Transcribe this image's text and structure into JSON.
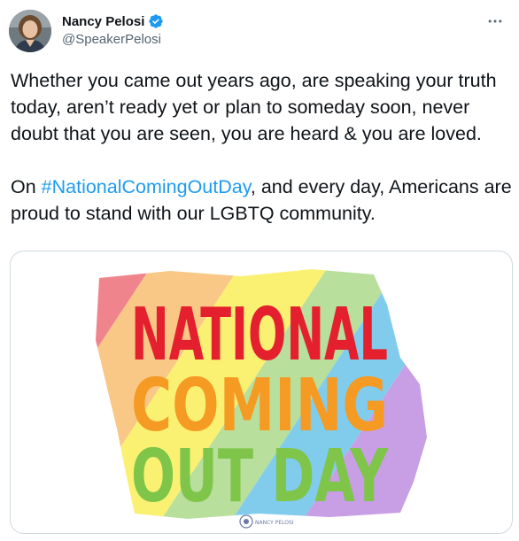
{
  "author": {
    "display_name": "Nancy Pelosi",
    "handle": "@SpeakerPelosi",
    "verified_icon": "verified-badge-icon",
    "avatar_icon": "profile-photo"
  },
  "more_icon": "more-options-icon",
  "tweet": {
    "text_part1": "Whether you came out years ago, are speaking your truth today, aren’t ready yet or plan to someday soon, never doubt that you are seen, you are heard & you are loved.\n\nOn ",
    "hashtag": "#NationalComingOutDay",
    "text_part2": ", and every day, Americans are proud to stand with our LGBTQ community."
  },
  "media": {
    "line1": "NATIONAL",
    "line2": "COMING",
    "line3": "OUT DAY",
    "seal_text": "NANCY PELOSI",
    "colors": [
      "#e4202e",
      "#f59a23",
      "#f6e500",
      "#7fc54a",
      "#1aa3dc",
      "#9b4fcf"
    ]
  },
  "colors": {
    "link": "#1d9bf0",
    "verified": "#1d9bf0",
    "secondary_text": "#536471"
  }
}
